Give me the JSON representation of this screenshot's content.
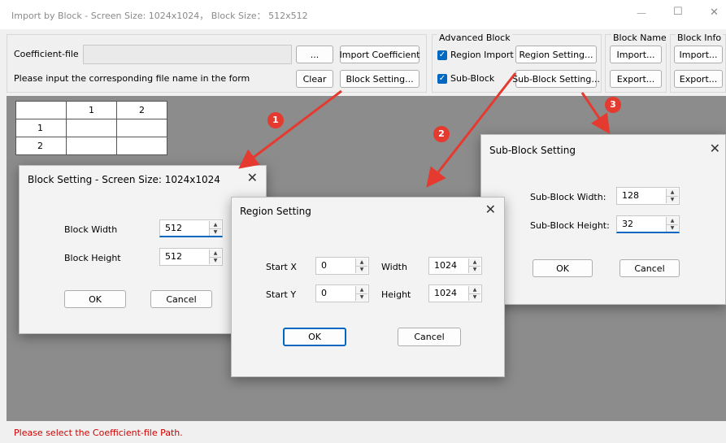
{
  "window": {
    "title": "Import by Block - Screen Size: 1024x1024， Block Size： 512x512",
    "minimize": "—",
    "maximize": "☐",
    "close": "✕"
  },
  "toolbar": {
    "coefficient_label": "Coefficient-file",
    "coefficient_value": "",
    "browse_label": "...",
    "import_coefficient_label": "Import Coefficient",
    "hint": "Please input the corresponding file name in the form",
    "clear_label": "Clear",
    "block_setting_label": "Block Setting...",
    "advanced_title": "Advanced Block",
    "region_import_label": "Region Import",
    "region_setting_label": "Region Setting...",
    "sub_block_label": "Sub-Block",
    "sub_block_setting_label": "Sub-Block Setting...",
    "block_name_title": "Block Name",
    "block_name_import": "Import...",
    "block_name_export": "Export...",
    "block_info_title": "Block Info",
    "block_info_import": "Import...",
    "block_info_export": "Export..."
  },
  "grid": {
    "col_headers": [
      "",
      "1",
      "2"
    ],
    "row_headers": [
      "1",
      "2"
    ]
  },
  "block_dialog": {
    "title": "Block Setting - Screen Size: 1024x1024",
    "width_label": "Block Width",
    "width_value": "512",
    "height_label": "Block Height",
    "height_value": "512",
    "ok": "OK",
    "cancel": "Cancel"
  },
  "region_dialog": {
    "title": "Region Setting",
    "start_x_label": "Start X",
    "start_x_value": "0",
    "start_y_label": "Start Y",
    "start_y_value": "0",
    "width_label": "Width",
    "width_value": "1024",
    "height_label": "Height",
    "height_value": "1024",
    "ok": "OK",
    "cancel": "Cancel"
  },
  "subblock_dialog": {
    "title": "Sub-Block Setting",
    "width_label": "Sub-Block Width:",
    "width_value": "128",
    "height_label": "Sub-Block Height:",
    "height_value": "32",
    "ok": "OK",
    "cancel": "Cancel"
  },
  "markers": [
    "1",
    "2",
    "3"
  ],
  "status": {
    "text": "Please select the Coefficient-file Path."
  },
  "colors": {
    "accent": "#0067c0",
    "annotation": "#e53a2f",
    "status_text": "#d00000"
  }
}
